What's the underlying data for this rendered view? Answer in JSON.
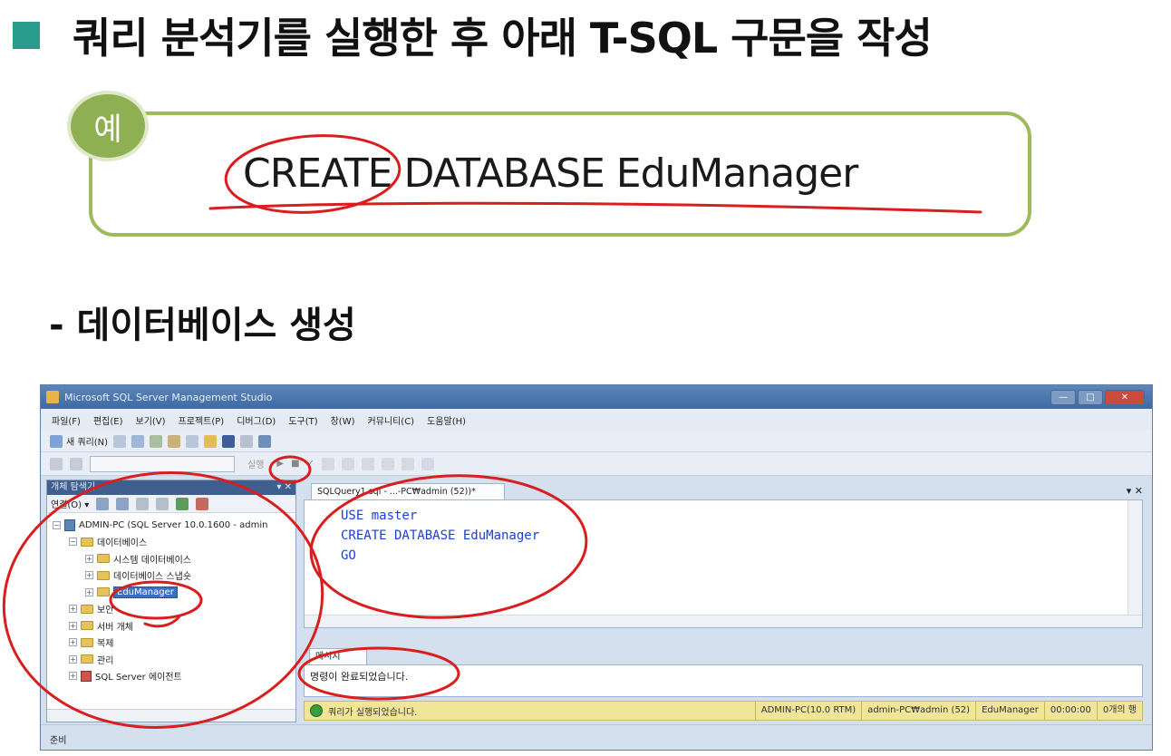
{
  "slide": {
    "title": "쿼리 분석기를 실행한 후 아래 T-SQL 구문을 작성",
    "example_badge": "예",
    "example_code": "CREATE DATABASE EduManager",
    "section_label": "- 데이터베이스 생성"
  },
  "window": {
    "title": "Microsoft SQL Server Management Studio",
    "buttons": {
      "minimize": "—",
      "maximize": "□",
      "close": "✕"
    }
  },
  "menu": {
    "items": [
      "파일(F)",
      "편집(E)",
      "보기(V)",
      "프로젝트(P)",
      "디버그(D)",
      "도구(T)",
      "창(W)",
      "커뮤니티(C)",
      "도움말(H)"
    ]
  },
  "toolbar": {
    "new_query": "새 쿼리(N)",
    "execute": "실행"
  },
  "object_explorer": {
    "title": "개체 탐색기",
    "connect": "연결(O) ▾",
    "tree": [
      {
        "label": "ADMIN-PC (SQL Server 10.0.1600 - admin",
        "indent": 0,
        "toggle": "⊟",
        "icon": "server"
      },
      {
        "label": "데이터베이스",
        "indent": 1,
        "toggle": "⊟",
        "icon": "folder"
      },
      {
        "label": "시스템 데이터베이스",
        "indent": 2,
        "toggle": "⊞",
        "icon": "folder"
      },
      {
        "label": "데이터베이스 스냅숏",
        "indent": 2,
        "toggle": "⊞",
        "icon": "folder"
      },
      {
        "label": "EduManager",
        "indent": 2,
        "toggle": "⊞",
        "icon": "database",
        "selected": true
      },
      {
        "label": "보안",
        "indent": 1,
        "toggle": "⊞",
        "icon": "folder"
      },
      {
        "label": "서버 개체",
        "indent": 1,
        "toggle": "⊞",
        "icon": "folder"
      },
      {
        "label": "복제",
        "indent": 1,
        "toggle": "⊞",
        "icon": "folder"
      },
      {
        "label": "관리",
        "indent": 1,
        "toggle": "⊞",
        "icon": "folder"
      },
      {
        "label": "SQL Server 에이전트",
        "indent": 1,
        "toggle": "⊞",
        "icon": "agent"
      }
    ]
  },
  "editor": {
    "tab_label": "SQLQuery1.sql - ...-PC₩admin (52))*",
    "tab_controls": "▾ ✕",
    "lines": [
      "USE master",
      "CREATE DATABASE EduManager",
      "GO"
    ]
  },
  "messages": {
    "tab_label": "메시지",
    "text": "명령이 완료되었습니다."
  },
  "query_status": {
    "message": "쿼리가 실행되었습니다.",
    "server": "ADMIN-PC(10.0 RTM)",
    "user": "admin-PC₩admin (52)",
    "database": "EduManager",
    "elapsed": "00:00:00",
    "rows": "0개의 행"
  },
  "app_status": "준비",
  "colors": {
    "accent_bullet": "#2a9c8e",
    "example_border": "#9dbb5a",
    "annotation": "#d81e1e",
    "code_keyword": "#1c3fd8"
  }
}
